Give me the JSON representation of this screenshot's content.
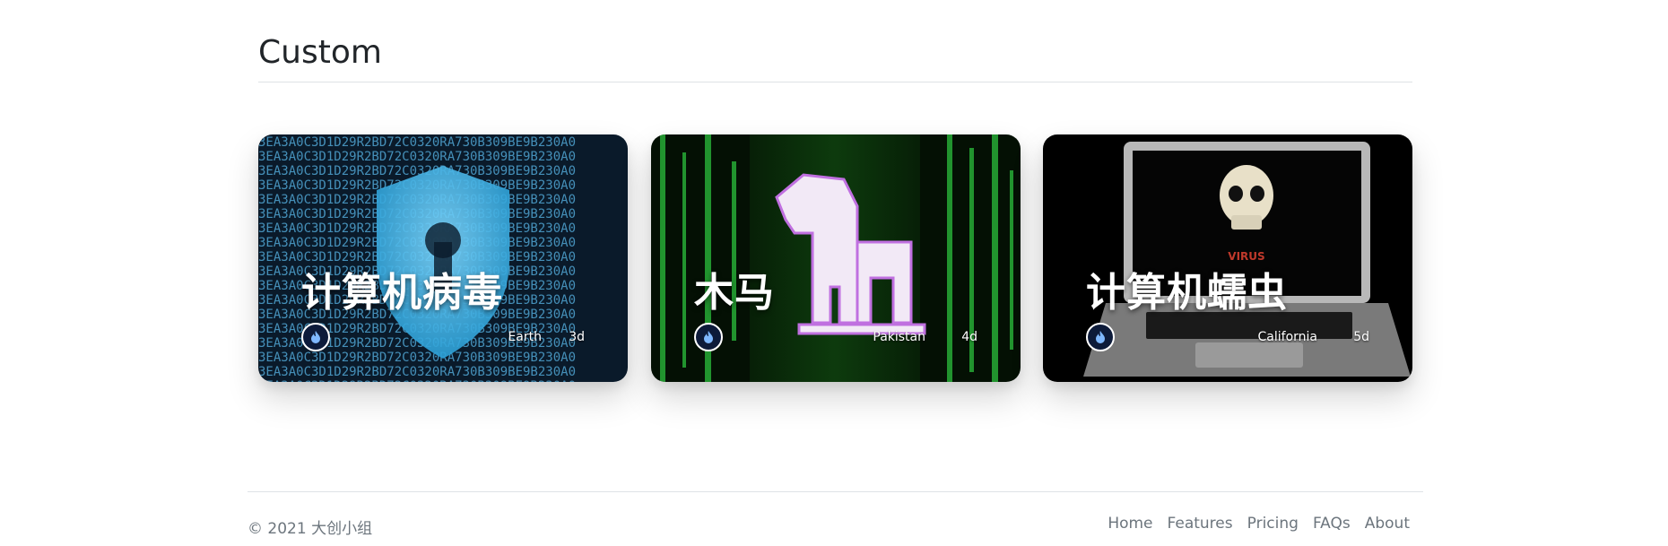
{
  "section": {
    "title": "Custom"
  },
  "cards": [
    {
      "title": "计算机病毒",
      "location": "Earth",
      "time": "3d",
      "icon": "flame-icon",
      "image": "shield-over-hex-code"
    },
    {
      "title": "木马",
      "location": "Pakistan",
      "time": "4d",
      "icon": "flame-icon",
      "image": "trojan-horse-over-green-matrix"
    },
    {
      "title": "计算机蠕虫",
      "location": "California",
      "time": "5d",
      "icon": "flame-icon",
      "image": "laptop-with-skull-virus"
    }
  ],
  "card3_screen_text": "VIRUS",
  "footer": {
    "copyright": "© 2021 大创小组",
    "links": [
      "Home",
      "Features",
      "Pricing",
      "FAQs",
      "About"
    ]
  },
  "colors": {
    "text": "#212529",
    "muted": "#6c757d",
    "divider": "#dee2e6"
  }
}
